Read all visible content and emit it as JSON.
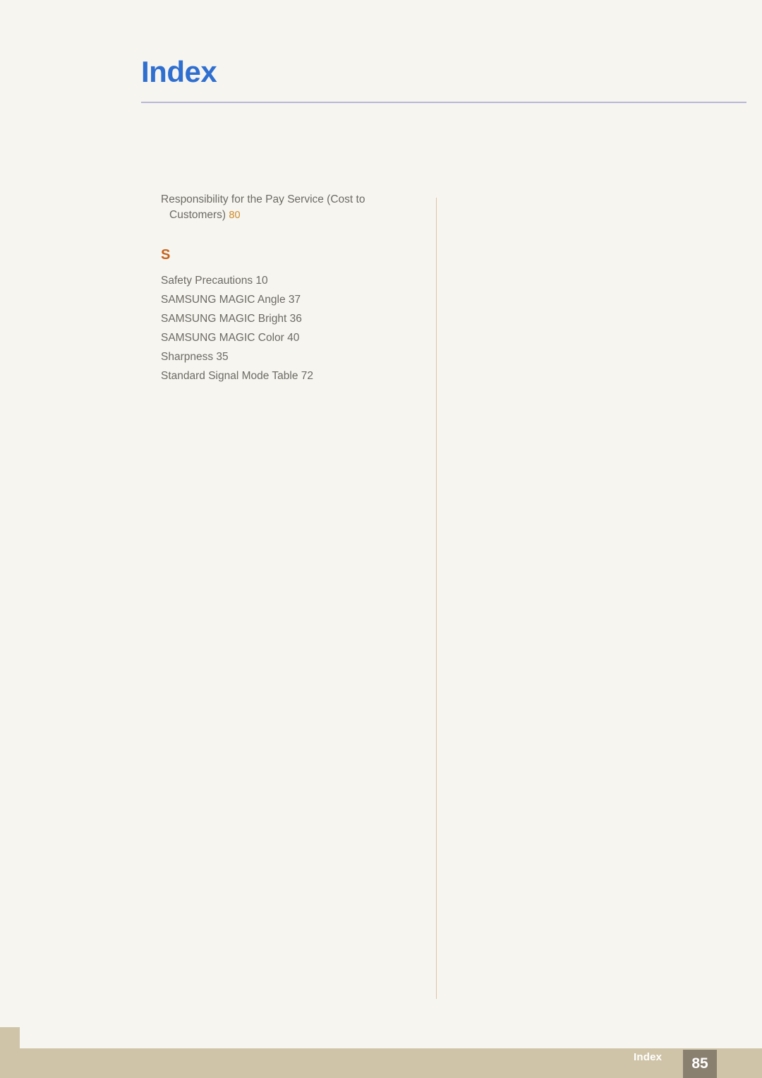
{
  "document": {
    "title": "Index",
    "footer": {
      "label": "Index",
      "page_number": "85"
    },
    "colors": {
      "title": "#2f6fd0",
      "section_letter": "#c8621e",
      "entry_text": "#6d6a63",
      "page_number_accent": "#cf8b2b",
      "band": "#cfc4a8",
      "page_box": "#8a8070",
      "background": "#f6f5f0",
      "divider": "#e3c0a8",
      "title_rule": "#b9b6d8"
    },
    "index": {
      "continued_entry": {
        "line1": "Responsibility for the Pay Service (Cost to",
        "line2": "Customers)",
        "page": "80"
      },
      "sections": [
        {
          "letter": "S",
          "entries": [
            {
              "label": "Safety Precautions",
              "page": "10"
            },
            {
              "label": "SAMSUNG MAGIC Angle",
              "page": "37"
            },
            {
              "label": "SAMSUNG MAGIC Bright",
              "page": "36"
            },
            {
              "label": "SAMSUNG MAGIC Color",
              "page": "40"
            },
            {
              "label": "Sharpness",
              "page": "35"
            },
            {
              "label": "Standard Signal Mode Table",
              "page": "72"
            }
          ]
        }
      ]
    }
  }
}
